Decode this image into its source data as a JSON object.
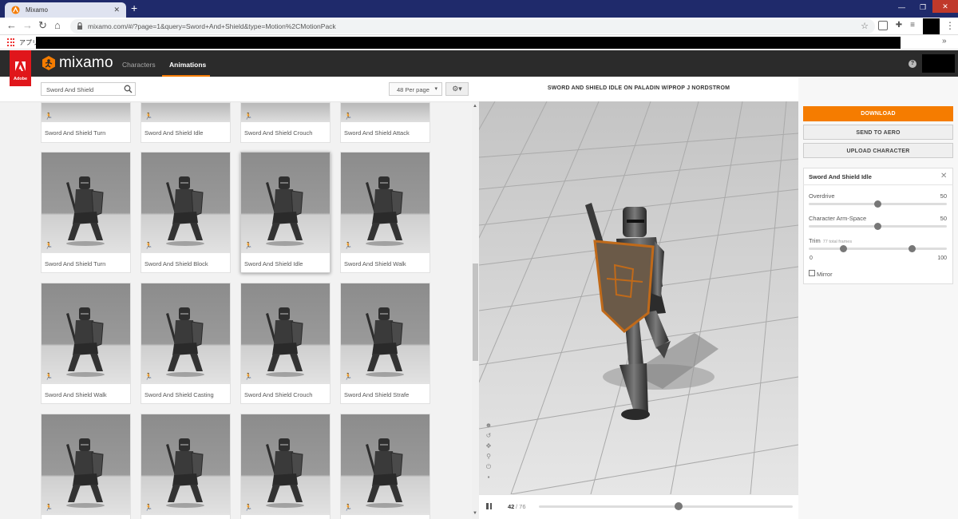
{
  "browser": {
    "tab_title": "Mixamo",
    "tab_close": "✕",
    "new_tab": "+",
    "url": "mixamo.com/#/?page=1&query=Sword+And+Shield&type=Motion%2CMotionPack",
    "bookmarks_apps_label": "アプリ",
    "bookmarks_more": "»",
    "window_min": "—",
    "window_max": "❐",
    "window_close": "✕"
  },
  "app": {
    "brand": "mixamo",
    "adobe_label": "Adobe",
    "nav": {
      "characters": "Characters",
      "animations": "Animations"
    },
    "help": "?",
    "accent_color": "#f57c00"
  },
  "search": {
    "value": "Sword And Shield"
  },
  "per_page": {
    "selected": "48 Per page"
  },
  "settings_label": "⚙▾",
  "animations": [
    {
      "label": "Sword And Shield Turn"
    },
    {
      "label": "Sword And Shield Idle"
    },
    {
      "label": "Sword And Shield Crouch"
    },
    {
      "label": "Sword And Shield Attack"
    },
    {
      "label": "Sword And Shield Turn"
    },
    {
      "label": "Sword And Shield Block"
    },
    {
      "label": "Sword And Shield Idle",
      "selected": true
    },
    {
      "label": "Sword And Shield Walk"
    },
    {
      "label": "Sword And Shield Walk"
    },
    {
      "label": "Sword And Shield Casting"
    },
    {
      "label": "Sword And Shield Crouch"
    },
    {
      "label": "Sword And Shield Strafe"
    },
    {
      "label": ""
    },
    {
      "label": ""
    },
    {
      "label": ""
    },
    {
      "label": ""
    }
  ],
  "preview": {
    "title": "SWORD AND SHIELD IDLE ON PALADIN W/PROP J NORDSTROM",
    "current_frame": "42",
    "frame_separator": "/ 76",
    "total_frames": 76,
    "playhead_position": 0.55
  },
  "actions": {
    "download": "DOWNLOAD",
    "send_to_aero": "SEND TO AERO",
    "upload_character": "UPLOAD CHARACTER"
  },
  "parameters": {
    "title": "Sword And Shield Idle",
    "close": "✕",
    "overdrive": {
      "label": "Overdrive",
      "value": "50"
    },
    "arm_space": {
      "label": "Character Arm-Space",
      "value": "50"
    },
    "trim": {
      "label": "Trim",
      "note": "77 total frames",
      "min": "0",
      "max": "100",
      "start": 0.25,
      "end": 0.75
    },
    "mirror": {
      "label": "Mirror",
      "checked": false
    }
  }
}
